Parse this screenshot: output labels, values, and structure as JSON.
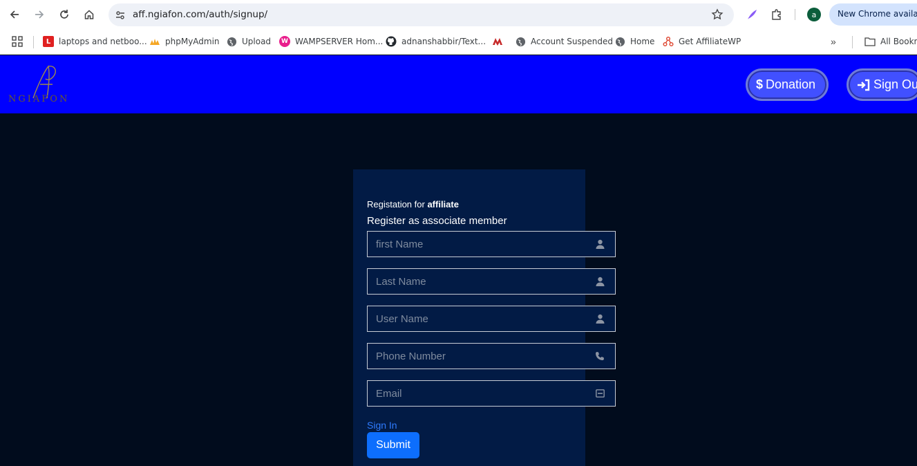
{
  "browser": {
    "url": "aff.ngiafon.com/auth/signup/",
    "avatar_letter": "a",
    "update_label": "New Chrome available"
  },
  "bookmarks": [
    {
      "label": "laptops and netboo...",
      "fav": "L",
      "color": "#e02020"
    },
    {
      "label": "phpMyAdmin",
      "fav": "pma",
      "color": "#f5a623"
    },
    {
      "label": "Upload",
      "fav": "globe",
      "color": "#5f6368"
    },
    {
      "label": "WAMPSERVER Hom...",
      "fav": "W",
      "color": "#e91e8c"
    },
    {
      "label": "adnanshabbir/Text...",
      "fav": "github",
      "color": "#24292e"
    },
    {
      "label": "",
      "fav": "M",
      "color": "#c62828"
    },
    {
      "label": "Account Suspended",
      "fav": "globe",
      "color": "#5f6368"
    },
    {
      "label": "Home",
      "fav": "globe",
      "color": "#5f6368"
    },
    {
      "label": "Get AffiliateWP",
      "fav": "affwp",
      "color": "#e04e39"
    }
  ],
  "bookmarks_more": "»",
  "all_bookmarks": "All Bookmarks",
  "header": {
    "logo_text": "NGIAFON",
    "donation_label": "Donation",
    "signout_label": "Sign Out"
  },
  "form": {
    "title_prefix": "Registation for ",
    "title_bold": "affiliate",
    "subtitle": "Register as associate member",
    "fields": [
      {
        "placeholder": "first Name",
        "icon": "user-icon"
      },
      {
        "placeholder": "Last Name",
        "icon": "user-icon"
      },
      {
        "placeholder": "User Name",
        "icon": "user-icon"
      },
      {
        "placeholder": "Phone Number",
        "icon": "phone-icon"
      },
      {
        "placeholder": "Email",
        "icon": "envelope-icon"
      }
    ],
    "signin_label": "Sign In",
    "submit_label": "Submit"
  },
  "colors": {
    "header_bg": "#0000ff",
    "page_bg": "#010c1d",
    "panel_bg": "#021b45",
    "submit_bg": "#0d6efd",
    "link": "#2f7cff"
  }
}
